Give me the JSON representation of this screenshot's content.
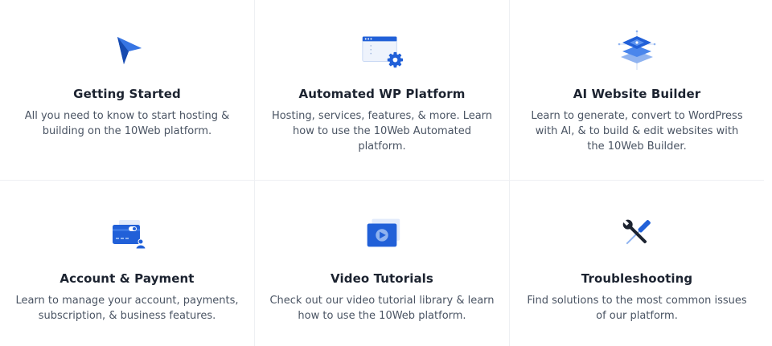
{
  "cards": [
    {
      "icon": "cursor-arrow-icon",
      "title": "Getting Started",
      "desc_lines": [
        "All you need to know to start hosting &",
        "building on the 10Web platform."
      ]
    },
    {
      "icon": "browser-gear-icon",
      "title": "Automated WP Platform",
      "desc_lines": [
        "Hosting, services, features, & more. Learn",
        "how to use the 10Web Automated platform."
      ]
    },
    {
      "icon": "layers-ai-icon",
      "title": "AI Website Builder",
      "desc_lines": [
        "Learn to generate, convert to WordPress",
        "with AI, & to build & edit websites with",
        "the 10Web Builder."
      ]
    },
    {
      "icon": "credit-card-user-icon",
      "title": "Account & Payment",
      "desc_lines": [
        "Learn to manage your account, payments,",
        "subscription, & business features."
      ]
    },
    {
      "icon": "video-play-icon",
      "title": "Video Tutorials",
      "desc_lines": [
        "Check out our video tutorial library & learn",
        "how to use the 10Web platform."
      ]
    },
    {
      "icon": "wrench-screwdriver-icon",
      "title": "Troubleshooting",
      "desc_lines": [
        "Find solutions to the most common issues",
        "of our platform."
      ]
    }
  ],
  "colors": {
    "brand_blue": "#2160d8",
    "light_blue": "#8fb3f0",
    "pale_blue": "#e3ebfb",
    "title_text": "#1c2330",
    "body_text": "#4a5463"
  }
}
